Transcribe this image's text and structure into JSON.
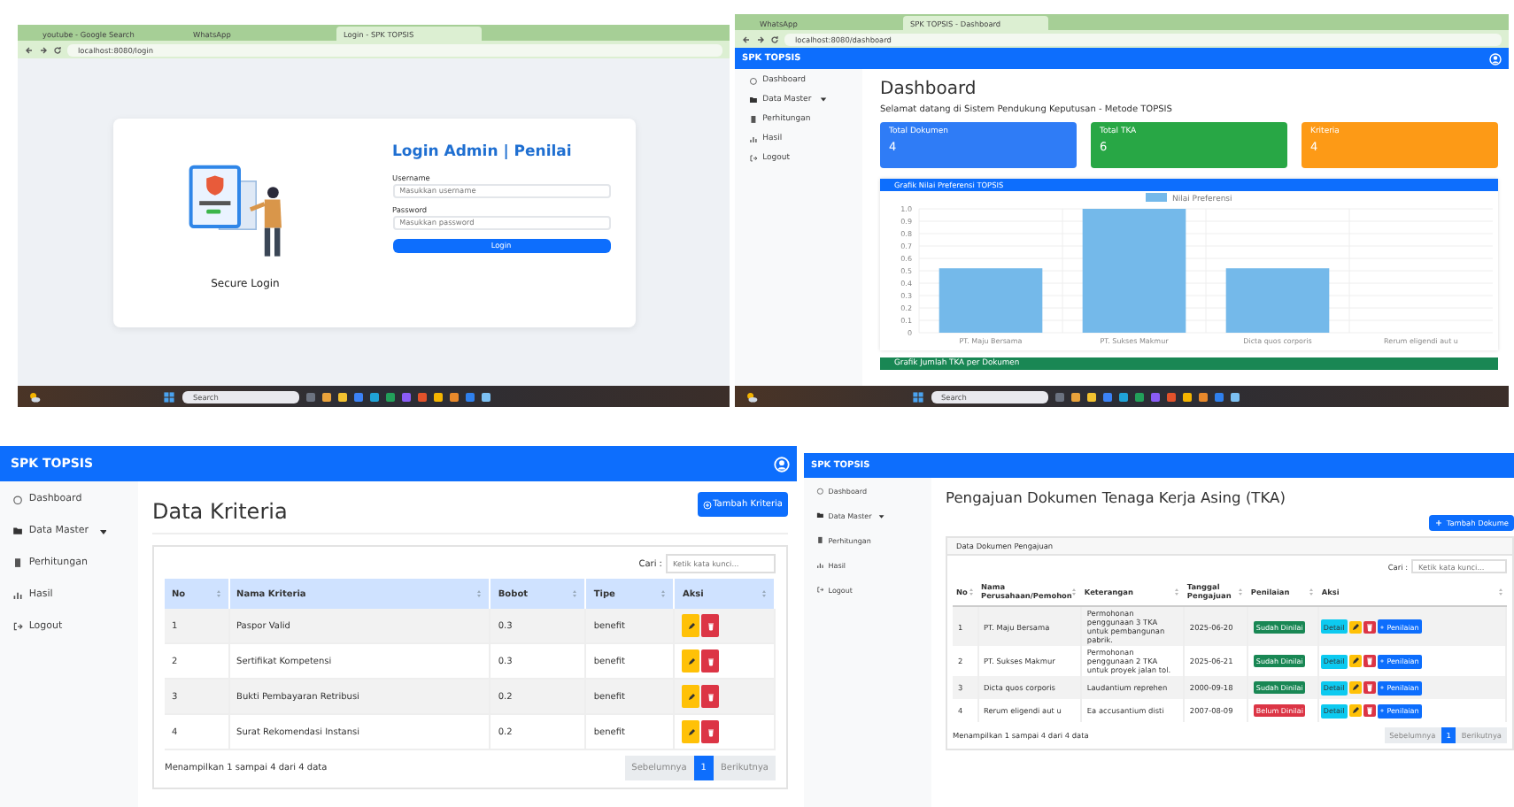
{
  "login_screen": {
    "browser": {
      "tabs": [
        {
          "label": "youtube - Google Search",
          "selected": false
        },
        {
          "label": "WhatsApp",
          "selected": false
        },
        {
          "label": "Login - SPK TOPSIS",
          "selected": true
        }
      ],
      "url": "localhost:8080/login"
    },
    "caption": "Secure Login",
    "title": "Login Admin | Penilai",
    "fields": [
      {
        "label": "Username",
        "placeholder": "Masukkan username"
      },
      {
        "label": "Password",
        "placeholder": "Masukkan password"
      }
    ],
    "submit": "Login",
    "taskbar": {
      "search": "Search"
    }
  },
  "dashboard_screen": {
    "browser": {
      "tabs": [
        {
          "label": "WhatsApp",
          "selected": false
        },
        {
          "label": "SPK TOPSIS - Dashboard",
          "selected": true
        }
      ],
      "url": "localhost:8080/dashboard"
    },
    "brand": "SPK TOPSIS",
    "sidebar": [
      {
        "label": "Dashboard",
        "kind": "link"
      },
      {
        "label": "Data Master",
        "kind": "dropdown"
      },
      {
        "label": "Perhitungan",
        "kind": "link"
      },
      {
        "label": "Hasil",
        "kind": "link"
      },
      {
        "label": "Logout",
        "kind": "link"
      }
    ],
    "title": "Dashboard",
    "subtitle": "Selamat datang di Sistem Pendukung Keputusan - Metode TOPSIS",
    "stats": [
      {
        "label": "Total Dokumen",
        "value": "4",
        "color": "#2f7cf6"
      },
      {
        "label": "Total TKA",
        "value": "6",
        "color": "#28a745"
      },
      {
        "label": "Kriteria",
        "value": "4",
        "color": "#fd9a16"
      }
    ],
    "chart_data": {
      "type": "bar",
      "title": "Grafik Nilai Preferensi TOPSIS",
      "categories": [
        "PT. Maju Bersama",
        "PT. Sukses Makmur",
        "Dicta quos corporis",
        "Rerum eligendi aut u"
      ],
      "series": [
        {
          "name": "Nilai Preferensi",
          "color": "#74b9ea",
          "values": [
            0.52,
            1.0,
            0.52,
            0
          ]
        }
      ],
      "grid": true,
      "ylim": [
        0,
        1
      ],
      "yticks": [
        0,
        0.1,
        0.2,
        0.3,
        0.4,
        0.5,
        0.6,
        0.7,
        0.8,
        0.9,
        {
          "value": 1,
          "label": "1.0"
        }
      ]
    },
    "next_card_title": "Grafik Jumlah TKA per Dokumen",
    "taskbar": {
      "search": "Search"
    }
  },
  "kriteria_screen": {
    "brand": "SPK TOPSIS",
    "sidebar": [
      {
        "label": "Dashboard",
        "kind": "link"
      },
      {
        "label": "Data Master",
        "kind": "dropdown"
      },
      {
        "label": "Perhitungan",
        "kind": "link"
      },
      {
        "label": "Hasil",
        "kind": "link"
      },
      {
        "label": "Logout",
        "kind": "link"
      }
    ],
    "title": "Data Kriteria",
    "add_button": "Tambah Kriteria",
    "search": {
      "label": "Cari :",
      "placeholder": "Ketik kata kunci..."
    },
    "table": {
      "columns": [
        "No",
        "Nama Kriteria",
        "Bobot",
        "Tipe",
        "Aksi"
      ],
      "rows": [
        {
          "no": "1",
          "name": "Paspor Valid",
          "weight": "0.3",
          "type": "benefit"
        },
        {
          "no": "2",
          "name": "Sertifikat Kompetensi",
          "weight": "0.3",
          "type": "benefit"
        },
        {
          "no": "3",
          "name": "Bukti Pembayaran Retribusi",
          "weight": "0.2",
          "type": "benefit"
        },
        {
          "no": "4",
          "name": "Surat Rekomendasi Instansi",
          "weight": "0.2",
          "type": "benefit"
        }
      ]
    },
    "info": "Menampilkan 1 sampai 4 dari 4 data",
    "pagination": [
      {
        "label": "Sebelumnya",
        "selected": false
      },
      {
        "label": "1",
        "selected": true
      },
      {
        "label": "Berikutnya",
        "selected": false
      }
    ]
  },
  "pengajuan_screen": {
    "brand": "SPK TOPSIS",
    "sidebar": [
      {
        "label": "Dashboard",
        "kind": "link"
      },
      {
        "label": "Data Master",
        "kind": "dropdown"
      },
      {
        "label": "Perhitungan",
        "kind": "link"
      },
      {
        "label": "Hasil",
        "kind": "link"
      },
      {
        "label": "Logout",
        "kind": "link"
      }
    ],
    "title": "Pengajuan Dokumen Tenaga Kerja Asing (TKA)",
    "add_button": "Tambah Dokume",
    "card_title": "Data Dokumen Pengajuan",
    "search": {
      "label": "Cari :",
      "placeholder": "Ketik kata kunci..."
    },
    "table": {
      "columns": [
        "No",
        "Nama Perusahaan/Pemohon",
        "Keterangan",
        "Tanggal Pengajuan",
        "Penilaian",
        "Aksi"
      ],
      "rows": [
        {
          "no": "1",
          "name": "PT. Maju Bersama",
          "note": "Permohonan penggunaan 3 TKA untuk pembangunan pabrik.",
          "date": "2025-06-20",
          "status": "Sudah Dinilai",
          "assessed": true,
          "detail": "Detail",
          "assess": "Penilaian"
        },
        {
          "no": "2",
          "name": "PT. Sukses Makmur",
          "note": "Permohonan penggunaan 2 TKA untuk proyek jalan tol.",
          "date": "2025-06-21",
          "status": "Sudah Dinilai",
          "assessed": true,
          "detail": "Detail",
          "assess": "Penilaian"
        },
        {
          "no": "3",
          "name": "Dicta quos corporis",
          "note": "Laudantium reprehen",
          "date": "2000-09-18",
          "status": "Sudah Dinilai",
          "assessed": true,
          "detail": "Detail",
          "assess": "Penilaian"
        },
        {
          "no": "4",
          "name": "Rerum eligendi aut u",
          "note": "Ea accusantium disti",
          "date": "2007-08-09",
          "status": "Belum Dinilai",
          "assessed": false,
          "detail": "Detail",
          "assess": "Penilaian"
        }
      ]
    },
    "info": "Menampilkan 1 sampai 4 dari 4 data",
    "pagination": [
      {
        "label": "Sebelumnya",
        "selected": false
      },
      {
        "label": "1",
        "selected": true
      },
      {
        "label": "Berikutnya",
        "selected": false
      }
    ]
  }
}
